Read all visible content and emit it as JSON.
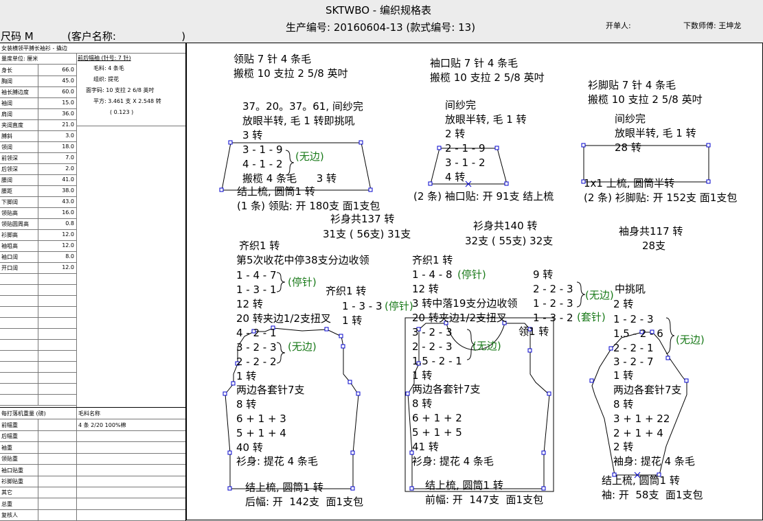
{
  "header": {
    "title": "SKTWBO - 编织规格表",
    "production_no": "生产编号: 20160604-13 (款式编号: 13)",
    "order_by": "开单人:",
    "master": "下数师傅: 王坤龙",
    "size": "尺码 M",
    "customer": "(客户名称:                    )"
  },
  "left": {
    "style_name": "女装横领平膊长袖衫 - 撬边",
    "unit_label": "量度单位: 厘米",
    "front_rib_title": "前后幅袖 (针号: 7 针)",
    "yarn": "毛料: 4 条毛",
    "stitch": "组织: 提花",
    "tension": "面字码: 10 支拉 2 6/8 英吋",
    "square": "平方: 3.461 支 X 2.548 转",
    "square2": "( 0.123 )",
    "measurements": [
      {
        "k": "身长",
        "v": "66.0"
      },
      {
        "k": "胸阔",
        "v": "45.0"
      },
      {
        "k": "袖长膊边度",
        "v": "60.0"
      },
      {
        "k": "袖阔",
        "v": "15.0"
      },
      {
        "k": "肩阔",
        "v": "36.0"
      },
      {
        "k": "夹阔直度",
        "v": "21.0"
      },
      {
        "k": "膊斜",
        "v": "3.0"
      },
      {
        "k": "领阔",
        "v": "18.0"
      },
      {
        "k": "前领深",
        "v": "7.0"
      },
      {
        "k": "后领深",
        "v": "2.0"
      },
      {
        "k": "腰阔",
        "v": "41.0"
      },
      {
        "k": "腰距",
        "v": "38.0"
      },
      {
        "k": "下脚阔",
        "v": "43.0"
      },
      {
        "k": "领贴高",
        "v": "16.0"
      },
      {
        "k": "领贴圆周高",
        "v": "0.8"
      },
      {
        "k": "衫脚高",
        "v": "12.0"
      },
      {
        "k": "袖咀高",
        "v": "12.0"
      },
      {
        "k": "袖口阔",
        "v": "8.0"
      },
      {
        "k": "开口阔",
        "v": "12.0"
      }
    ],
    "weight_title": "每打落机重量 (磅)",
    "yarn_name_title": "毛料名称",
    "weights": [
      {
        "k": "前幅重",
        "v": "4 条 2/20 100%棉"
      },
      {
        "k": "后幅重",
        "v": ""
      },
      {
        "k": "袖重",
        "v": ""
      },
      {
        "k": "领贴重",
        "v": ""
      },
      {
        "k": "袖口贴重",
        "v": ""
      },
      {
        "k": "衫脚贴重",
        "v": ""
      },
      {
        "k": "其它",
        "v": ""
      },
      {
        "k": "总重",
        "v": ""
      },
      {
        "k": "复核人",
        "v": ""
      }
    ]
  },
  "collar": {
    "l1": "领贴  7 针 4 条毛",
    "l2": "搬榄 10 支拉 2 5/8 英吋",
    "l3": "37。20。37。61, 间纱完",
    "l4": "放眼半转, 毛 1 转即挑吼",
    "l5": "3 转",
    "l6": "3 - 1 - 9",
    "l7": "4 - 1 - 2",
    "l7g": "(无边)",
    "l8": "搬榄 4 条毛      3 转",
    "l9": "结上梳, 圆筒1 转",
    "l10": "(1 条) 领贴: 开 180支 面1支包"
  },
  "cuff": {
    "l1": "袖口贴  7 针 4 条毛",
    "l2": "搬榄 10 支拉 2 5/8 英吋",
    "l3": "间纱完",
    "l4": "放眼半转, 毛 1 转",
    "l5": "2 转",
    "l6": "2 - 1 - 9",
    "l7": "3 - 1 - 2",
    "l8": "4 转",
    "l9": "(2 条) 袖口贴: 开 91支  结上梳"
  },
  "hem": {
    "l1": "衫脚贴  7 针 4 条毛",
    "l2": "搬榄 10 支拉 2 5/8 英吋",
    "l3": "间纱完",
    "l4": "放眼半转, 毛 1 转",
    "l5": "28 转",
    "l6": "1x1 上梳, 圆筒半转",
    "l7": "(2 条) 衫脚贴: 开 152支  面1支包"
  },
  "back": {
    "total": "衫身共137 转",
    "split": "31支 ( 56支) 31支",
    "l1": "齐织1 转",
    "l2": "第5次收花中停38支分边收领",
    "l3": "1 - 4 - 7",
    "l4": "1 - 3 - 1",
    "lg1": "(停针)",
    "l5": "12 转",
    "l6": "20 转夹边1/2支扭叉",
    "l7": "4 - 2 - 1",
    "l8": "3 - 2 - 3",
    "lg2": "(无边)",
    "l9": "2 - 2 - 2",
    "l10": "1 转",
    "l11": "两边各套针7支",
    "l12": "8 转",
    "l13": "6 + 1 + 3",
    "l14": "5 + 1 + 4",
    "l15": "40 转",
    "l16": "衫身: 提花 4 条毛",
    "l17": "结上梳, 圆筒1 转",
    "l18": "后幅: 开  142支  面1支包",
    "m1": "齐织1 转",
    "m2": "1 - 3 - 3",
    "mg": "(停针)",
    "m3": "1 转"
  },
  "front": {
    "total": "衫身共140 转",
    "split": "32支 ( 55支) 32支",
    "l1": "齐织1 转",
    "l2": "1 - 4 - 8",
    "lg1": "(停针)",
    "l3": "12 转",
    "l4": "3 转中落19支分边收领",
    "l5": "20 转夹边1/2支扭叉",
    "l6": "3 - 2 - 3",
    "l7": "2 - 2 - 3",
    "l8": "1.5 - 2 - 1",
    "lg2": "(无边)",
    "l9": "1 转",
    "l10": "两边各套针7支",
    "l11": "8 转",
    "l12": "6 + 1 + 2",
    "l13": "5 + 1 + 5",
    "l14": "41 转",
    "l15": "衫身: 提花 4 条毛",
    "l16": "结上梳, 圆筒1 转",
    "l17": "前幅: 开  147支  面1支包",
    "r1": "9 转",
    "r2": "2 - 2 - 3",
    "r3": "1 - 2 - 3",
    "r4": "1 - 3 - 2",
    "rg1": "(无边)",
    "rg2": "(套针)",
    "r5": "领1 转"
  },
  "sleeve": {
    "total": "袖身共117 转",
    "split": "28支",
    "l1": "中挑吼",
    "l2": "2 转",
    "l3": "1 - 2 - 3",
    "l4": "1.5 - 2 - 6",
    "l5": "2 - 2 - 1",
    "l6": "3 - 2 - 7",
    "lg": "(无边)",
    "l7": "1 转",
    "l8": "两边各套针7支",
    "l9": "8 转",
    "l10": "3 + 1 + 22",
    "l11": "2 + 1 + 4",
    "l12": "2 转",
    "l13": "袖身: 提花 4 条毛",
    "l14": "结上梳, 圆筒1 转",
    "l15": "袖: 开  58支  面1支包"
  }
}
